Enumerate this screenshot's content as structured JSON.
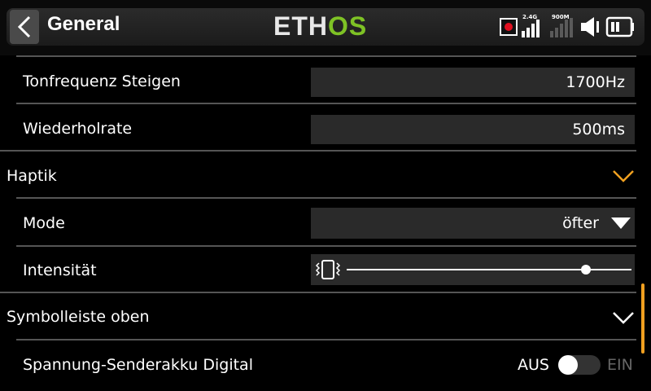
{
  "header": {
    "back_icon": "chevron-left-icon",
    "title": "General",
    "logo_a": "ETH",
    "logo_b": "OS",
    "status": {
      "rx1_label": "2.4G",
      "rx2_label": "900M"
    },
    "accent_color": "#7ec225"
  },
  "settings": {
    "tone_rise": {
      "label": "Tonfrequenz Steigen",
      "value": "1700Hz"
    },
    "repeat_rate": {
      "label": "Wiederholrate",
      "value": "500ms"
    },
    "haptic_section": {
      "label": "Haptik",
      "expanded": true,
      "chevron_color": "#f0a020"
    },
    "mode": {
      "label": "Mode",
      "value": "öfter"
    },
    "intensity": {
      "label": "Intensität",
      "level": 0.84
    },
    "toolbar_section": {
      "label": "Symbolleiste oben",
      "expanded": true
    },
    "tx_voltage": {
      "label": "Spannung-Senderakku Digital",
      "off_label": "AUS",
      "on_label": "EIN",
      "enabled": false
    }
  },
  "scroll_color": "#f0a020"
}
